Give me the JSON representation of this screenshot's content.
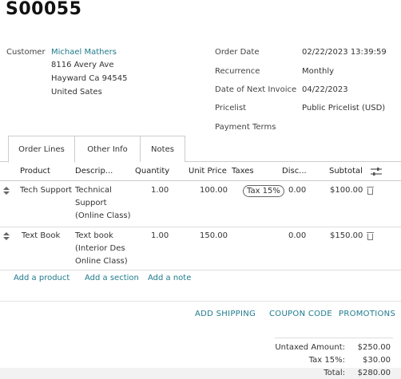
{
  "order": {
    "title": "S00055",
    "customer_label": "Customer",
    "customer_name": "Michael Mathers",
    "address": [
      "8116 Avery Ave",
      "Hayward Ca 94545",
      "United Sates"
    ],
    "fields": [
      {
        "label": "Order Date",
        "value": "02/22/2023 13:39:59"
      },
      {
        "label": "Recurrence",
        "value": "Monthly"
      },
      {
        "label": "Date of Next Invoice",
        "value": "04/22/2023"
      },
      {
        "label": "Pricelist",
        "value": "Public Pricelist (USD)"
      },
      {
        "label": "Payment Terms",
        "value": ""
      }
    ]
  },
  "tabs": [
    "Order Lines",
    "Other Info",
    "Notes"
  ],
  "table": {
    "headers": [
      "Product",
      "Descrip...",
      "Quantity",
      "Unit Price",
      "Taxes",
      "Disc...",
      "Subtotal"
    ],
    "rows": [
      {
        "product": "Tech Support",
        "desc": [
          "Technical",
          "Support",
          "(Online Class)"
        ],
        "qty": "1.00",
        "unit_price": "100.00",
        "tax": "Tax 15%",
        "disc": "0.00",
        "subtotal": "$100.00"
      },
      {
        "product": "Text Book",
        "desc": [
          "Text book",
          "(Interior Des",
          "Online Class)"
        ],
        "qty": "1.00",
        "unit_price": "150.00",
        "tax": "",
        "disc": "0.00",
        "subtotal": "$150.00"
      }
    ]
  },
  "add_links": [
    "Add a product",
    "Add a section",
    "Add a note"
  ],
  "actions": [
    "ADD SHIPPING",
    "COUPON CODE",
    "PROMOTIONS"
  ],
  "totals": [
    {
      "label": "Untaxed Amount:",
      "value": "$250.00"
    },
    {
      "label": "Tax 15%:",
      "value": "$30.00"
    },
    {
      "label": "Total:",
      "value": "$280.00"
    }
  ],
  "colors": {
    "link": "#1f7a8c"
  }
}
